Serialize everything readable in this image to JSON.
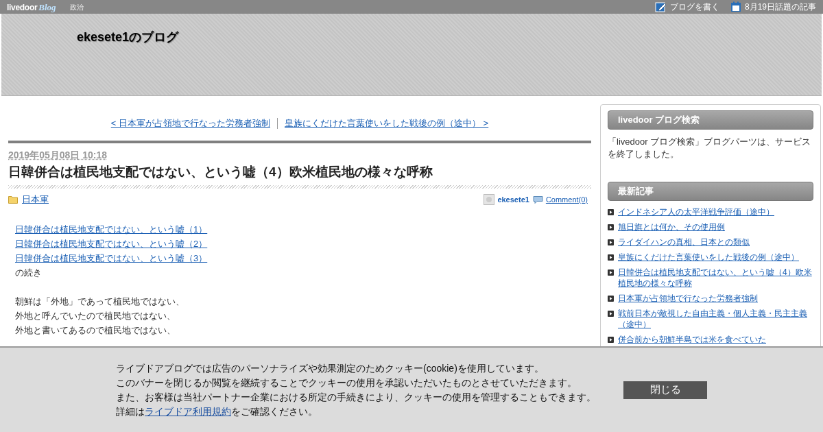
{
  "top_bar": {
    "logo_left": "livedoor",
    "logo_right": "Blog",
    "category": "政治",
    "actions": [
      {
        "kind": "write",
        "label": "ブログを書く"
      },
      {
        "kind": "calendar",
        "label": "8月19日話題の記事"
      }
    ]
  },
  "header": {
    "blog_title": "ekesete1のブログ"
  },
  "pager": {
    "prev": "< 日本軍が占領地で行なった労務者強制",
    "next": "皇族にくだけた言葉使いをした戦後の例（途中） >"
  },
  "article": {
    "date": "2019年05月08日 10:18",
    "title": "日韓併合は植民地支配ではない、という嘘（4）欧米植民地の様々な呼称",
    "category": "日本軍",
    "author": "ekesete1",
    "comments": "Comment(0)",
    "body": [
      {
        "kind": "link",
        "text": "日韓併合は植民地支配ではない、という嘘（1）"
      },
      {
        "kind": "link",
        "text": "日韓併合は植民地支配ではない、という嘘（2）"
      },
      {
        "kind": "link",
        "text": "日韓併合は植民地支配ではない、という嘘（3）"
      },
      {
        "kind": "text",
        "text": "の続き"
      },
      {
        "kind": "blank"
      },
      {
        "kind": "text",
        "text": "朝鮮は「外地」であって植民地ではない、"
      },
      {
        "kind": "text",
        "text": "外地と呼んでいたので植民地ではない、"
      },
      {
        "kind": "text",
        "text": "外地と書いてあるので植民地ではない、"
      }
    ]
  },
  "sidebar": {
    "search_widget": {
      "title": "livedoor ブログ検索",
      "text": "「livedoor ブログ検索」ブログパーツは、サービスを終了しました。"
    },
    "recent": {
      "title": "最新記事",
      "items": [
        "インドネシア人の太平洋戦争評価（途中）",
        "旭日旗とは何か、その使用例",
        "ライダイハンの真相、日本との類似",
        "皇族にくだけた言葉使いをした戦後の例（途中）",
        "日韓併合は植民地支配ではない、という嘘（4）欧米植民地の様々な呼称",
        "日本軍が占領地で行なった労務者強制",
        "戦前日本が敵視した自由主義・個人主義・民主主義（途中）",
        "併合前から朝鮮半島では米を食べていた"
      ]
    }
  },
  "cookie_banner": {
    "lines": [
      "ライブドアブログでは広告のパーソナライズや効果測定のためクッキー(cookie)を使用しています。",
      "このバナーを閉じるか閲覧を継続することでクッキーの使用を承認いただいたものとさせていただきます。",
      "また、お客様は当社パートナー企業における所定の手続きにより、クッキーの使用を管理することもできます。"
    ],
    "details_prefix": "詳細は",
    "details_link": "ライブドア利用規約",
    "details_suffix": "をご確認ください。",
    "close_button": "閉じる"
  }
}
